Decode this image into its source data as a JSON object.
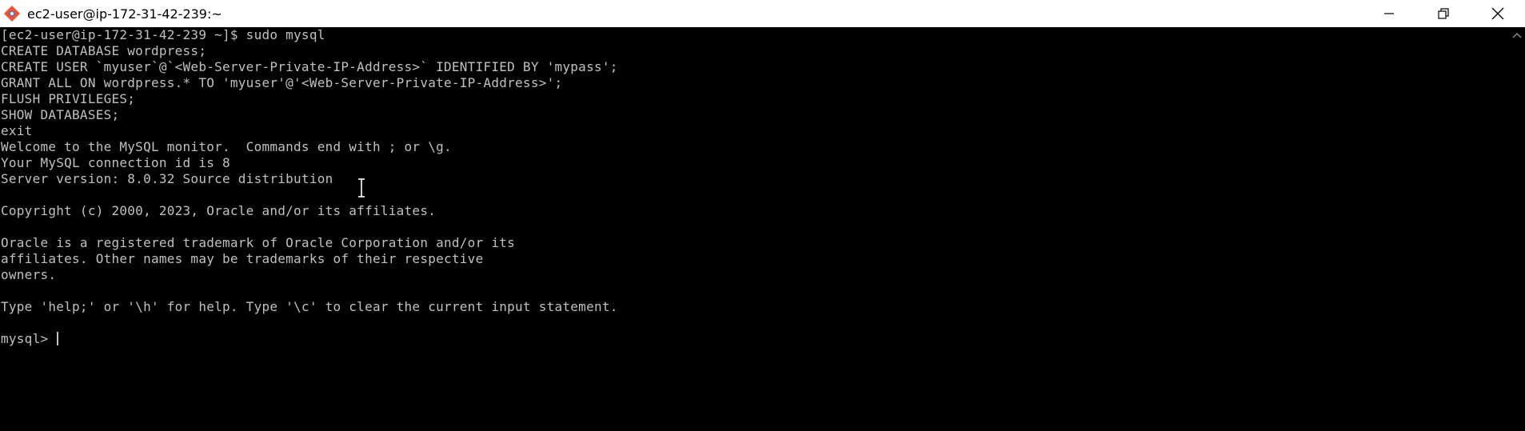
{
  "window": {
    "title": "ec2-user@ip-172-31-42-239:~",
    "app_icon": "git-bash-icon"
  },
  "controls": {
    "minimize_icon": "minimize-icon",
    "maximize_icon": "restore-icon",
    "close_icon": "close-icon"
  },
  "terminal": {
    "lines": [
      "[ec2-user@ip-172-31-42-239 ~]$ sudo mysql",
      "CREATE DATABASE wordpress;",
      "CREATE USER `myuser`@`<Web-Server-Private-IP-Address>` IDENTIFIED BY 'mypass';",
      "GRANT ALL ON wordpress.* TO 'myuser'@'<Web-Server-Private-IP-Address>';",
      "FLUSH PRIVILEGES;",
      "SHOW DATABASES;",
      "exit",
      "Welcome to the MySQL monitor.  Commands end with ; or \\g.",
      "Your MySQL connection id is 8",
      "Server version: 8.0.32 Source distribution",
      "",
      "Copyright (c) 2000, 2023, Oracle and/or its affiliates.",
      "",
      "Oracle is a registered trademark of Oracle Corporation and/or its",
      "affiliates. Other names may be trademarks of their respective",
      "owners.",
      "",
      "Type 'help;' or '\\h' for help. Type '\\c' to clear the current input statement.",
      ""
    ],
    "prompt": "mysql> "
  },
  "colors": {
    "background": "#000000",
    "foreground": "#c0c0c0",
    "titlebar": "#ffffff"
  }
}
